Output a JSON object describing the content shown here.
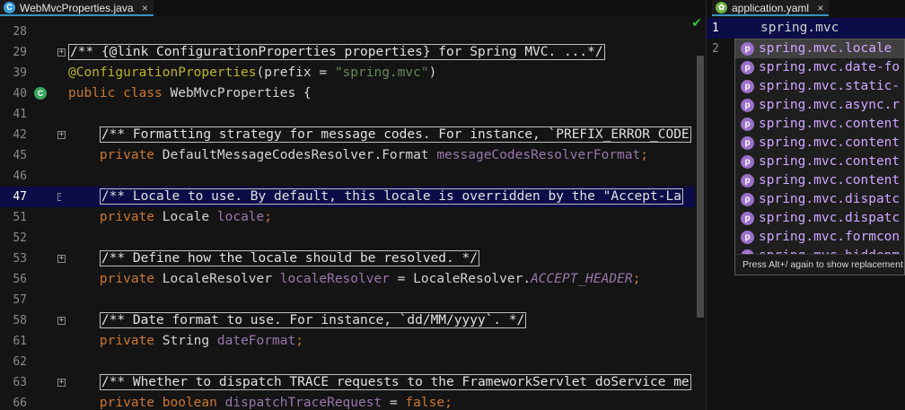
{
  "left_tab": {
    "icon": "java-class-icon",
    "title": "WebMvcProperties.java",
    "close": "×"
  },
  "right_tab": {
    "icon": "spring-icon",
    "title": "application.yaml",
    "close": "×"
  },
  "colors": {
    "keyword": "#cc7832",
    "annotation": "#bbb529",
    "string": "#6a8759",
    "field": "#9876aa",
    "highlight": "#0c0c48",
    "property_icon": "#9b70c9"
  },
  "code_lines": [
    {
      "num": "28",
      "segments": []
    },
    {
      "num": "29",
      "fold": true,
      "segments": [
        {
          "t": "/** {@link ConfigurationProperties properties} for Spring MVC. ...*/",
          "c": "cmt"
        }
      ]
    },
    {
      "num": "39",
      "segments": [
        {
          "t": "@ConfigurationProperties",
          "c": "ann"
        },
        {
          "t": "(prefix = ",
          "c": ""
        },
        {
          "t": "\"spring.mvc\"",
          "c": "str"
        },
        {
          "t": ")",
          "c": ""
        }
      ]
    },
    {
      "num": "40",
      "bean": true,
      "segments": [
        {
          "t": "public ",
          "c": "kw"
        },
        {
          "t": "class ",
          "c": "kw"
        },
        {
          "t": "WebMvcProperties {",
          "c": ""
        }
      ]
    },
    {
      "num": "41",
      "segments": []
    },
    {
      "num": "42",
      "fold": true,
      "segments": [
        {
          "t": "    ",
          "c": ""
        },
        {
          "t": "/** Formatting strategy for message codes. For instance, `PREFIX_ERROR_CODE",
          "c": "cmt"
        }
      ]
    },
    {
      "num": "45",
      "segments": [
        {
          "t": "    ",
          "c": ""
        },
        {
          "t": "private ",
          "c": "kw"
        },
        {
          "t": "DefaultMessageCodesResolver.Format ",
          "c": ""
        },
        {
          "t": "messageCodesResolverFormat",
          "c": "fld"
        },
        {
          "t": ";",
          "c": "kw"
        }
      ]
    },
    {
      "num": "46",
      "segments": []
    },
    {
      "num": "47",
      "fold": true,
      "current": true,
      "segments": [
        {
          "t": "    ",
          "c": ""
        },
        {
          "t": "/** Locale to use. By default, this locale is overridden by the \"Accept-La",
          "c": "cmt"
        }
      ]
    },
    {
      "num": "51",
      "segments": [
        {
          "t": "    ",
          "c": ""
        },
        {
          "t": "private ",
          "c": "kw"
        },
        {
          "t": "Locale ",
          "c": ""
        },
        {
          "t": "locale",
          "c": "fld"
        },
        {
          "t": ";",
          "c": "kw"
        }
      ]
    },
    {
      "num": "52",
      "segments": []
    },
    {
      "num": "53",
      "fold": true,
      "segments": [
        {
          "t": "    ",
          "c": ""
        },
        {
          "t": "/** Define how the locale should be resolved. */",
          "c": "cmt"
        }
      ]
    },
    {
      "num": "56",
      "segments": [
        {
          "t": "    ",
          "c": ""
        },
        {
          "t": "private ",
          "c": "kw"
        },
        {
          "t": "LocaleResolver ",
          "c": ""
        },
        {
          "t": "localeResolver",
          "c": "fld"
        },
        {
          "t": " = LocaleResolver.",
          "c": ""
        },
        {
          "t": "ACCEPT_HEADER",
          "c": "cst"
        },
        {
          "t": ";",
          "c": "kw"
        }
      ]
    },
    {
      "num": "57",
      "segments": []
    },
    {
      "num": "58",
      "fold": true,
      "segments": [
        {
          "t": "    ",
          "c": ""
        },
        {
          "t": "/** Date format to use. For instance, `dd/MM/yyyy`. */",
          "c": "cmt"
        }
      ]
    },
    {
      "num": "61",
      "segments": [
        {
          "t": "    ",
          "c": ""
        },
        {
          "t": "private ",
          "c": "kw"
        },
        {
          "t": "String ",
          "c": ""
        },
        {
          "t": "dateFormat",
          "c": "fld"
        },
        {
          "t": ";",
          "c": "kw"
        }
      ]
    },
    {
      "num": "62",
      "segments": []
    },
    {
      "num": "63",
      "fold": true,
      "segments": [
        {
          "t": "    ",
          "c": ""
        },
        {
          "t": "/** Whether to dispatch TRACE requests to the FrameworkServlet doService me",
          "c": "cmt"
        }
      ]
    },
    {
      "num": "66",
      "segments": [
        {
          "t": "    ",
          "c": ""
        },
        {
          "t": "private ",
          "c": "kw"
        },
        {
          "t": "boolean ",
          "c": "kw"
        },
        {
          "t": "dispatchTraceRequest",
          "c": "fld"
        },
        {
          "t": " = ",
          "c": ""
        },
        {
          "t": "false",
          "c": "kw"
        },
        {
          "t": ";",
          "c": "kw"
        }
      ]
    }
  ],
  "yaml_lines": [
    {
      "num": "1",
      "text": "spring.mvc"
    },
    {
      "num": "2",
      "text": ""
    }
  ],
  "completion": {
    "items": [
      {
        "icon": "p",
        "label": "spring.mvc.locale",
        "selected": true
      },
      {
        "icon": "p",
        "label": "spring.mvc.date-fo"
      },
      {
        "icon": "p",
        "label": "spring.mvc.static-"
      },
      {
        "icon": "p",
        "label": "spring.mvc.async.r"
      },
      {
        "icon": "p",
        "label": "spring.mvc.content"
      },
      {
        "icon": "p",
        "label": "spring.mvc.content"
      },
      {
        "icon": "p",
        "label": "spring.mvc.content"
      },
      {
        "icon": "p",
        "label": "spring.mvc.content"
      },
      {
        "icon": "p",
        "label": "spring.mvc.dispatc"
      },
      {
        "icon": "p",
        "label": "spring.mvc.dispatc"
      },
      {
        "icon": "p",
        "label": "spring.mvc.formcon"
      },
      {
        "icon": "p",
        "label": "spring.mvc.hiddenm"
      }
    ],
    "hint": "Press Alt+/ again to show replacement"
  }
}
